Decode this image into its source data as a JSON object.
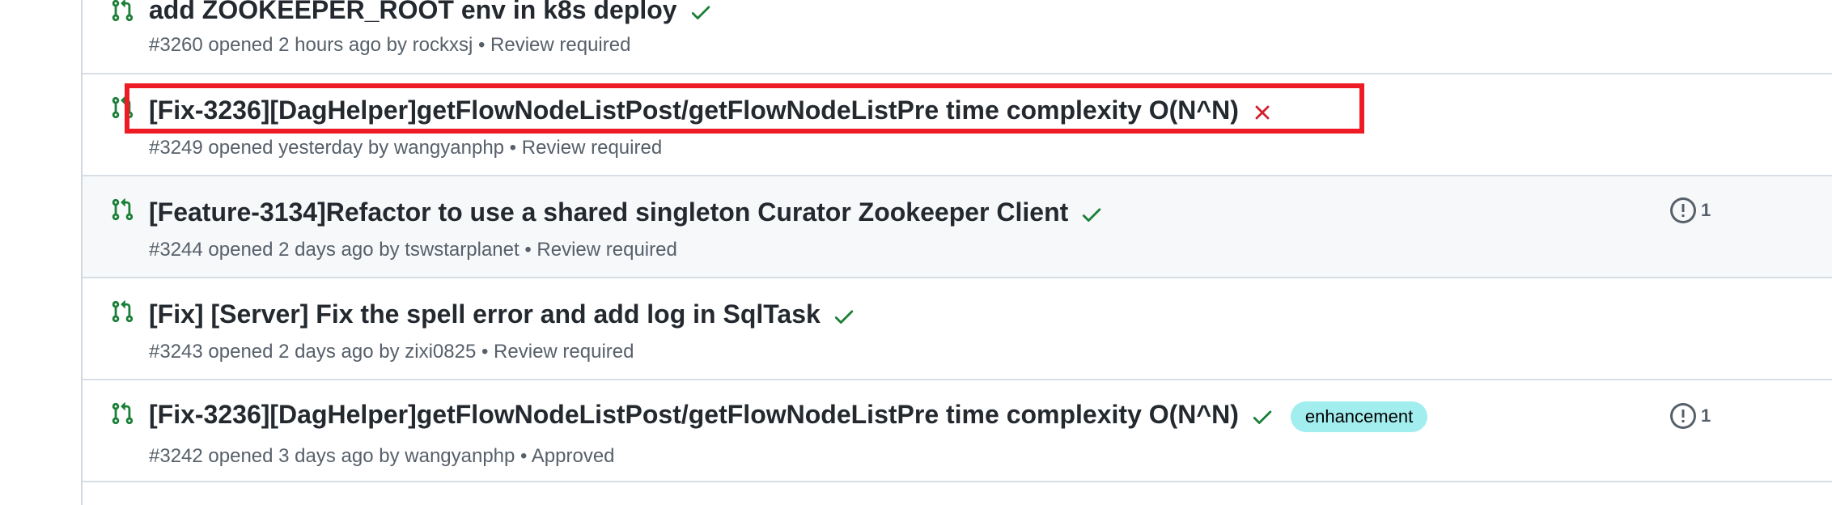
{
  "colors": {
    "pr_open_green": "#1a7f37",
    "check_green": "#1a7f37",
    "fail_red": "#cf222e",
    "label_bg": "#a2eeef",
    "highlight_red": "#ee1b24"
  },
  "pull_requests": [
    {
      "title": "add ZOOKEEPER_ROOT env in k8s deploy",
      "status_icon": "check-icon",
      "meta": "#3260 opened 2 hours ago by rockxsj • Review required"
    },
    {
      "title": "[Fix-3236][DagHelper]getFlowNodeListPost/getFlowNodeListPre time complexity O(N^N)",
      "status_icon": "x-icon",
      "meta": "#3249 opened yesterday by wangyanphp • Review required"
    },
    {
      "title": "[Feature-3134]Refactor to use a shared singleton Curator Zookeeper Client",
      "status_icon": "check-icon",
      "meta": "#3244 opened 2 days ago by tswstarplanet • Review required",
      "comments": "1"
    },
    {
      "title": "[Fix] [Server] Fix the spell error and add log in SqlTask",
      "status_icon": "check-icon",
      "meta": "#3243 opened 2 days ago by zixi0825 • Review required"
    },
    {
      "title": "[Fix-3236][DagHelper]getFlowNodeListPost/getFlowNodeListPre time complexity O(N^N)",
      "status_icon": "check-icon",
      "label": "enhancement",
      "meta": "#3242 opened 3 days ago by wangyanphp • Approved",
      "comments": "1"
    }
  ]
}
